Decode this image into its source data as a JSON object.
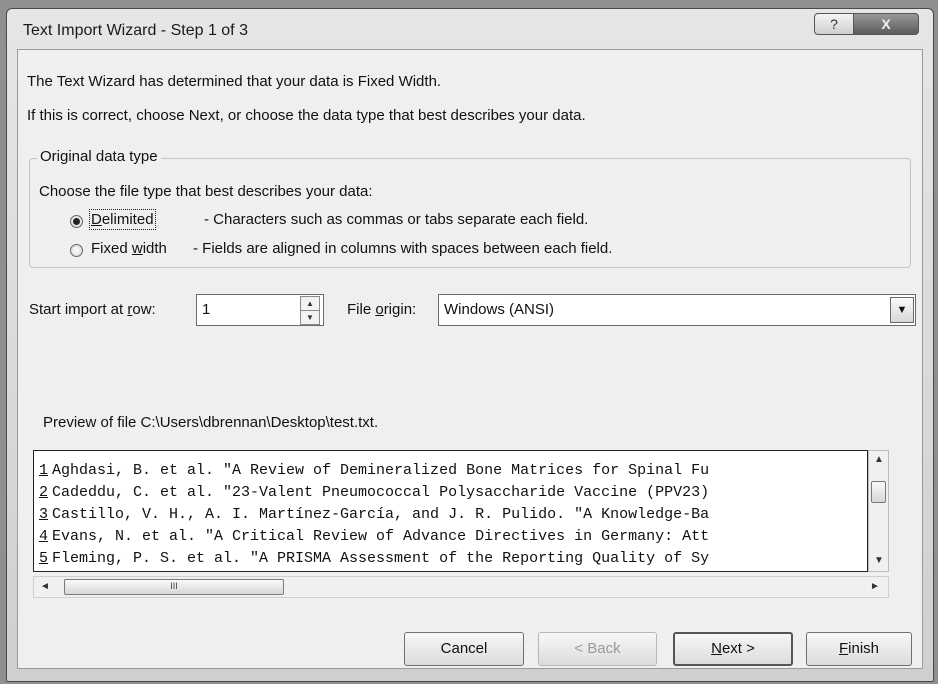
{
  "window": {
    "title": "Text Import Wizard - Step 1 of 3",
    "help_glyph": "?",
    "close_glyph": "X"
  },
  "intro": {
    "line1": "The Text Wizard has determined that your data is Fixed Width.",
    "line2": "If this is correct, choose Next, or choose the data type that best describes your data."
  },
  "data_type": {
    "group_label": "Original data type",
    "prompt": "Choose the file type that best describes your data:",
    "options": [
      {
        "label": "Delimited",
        "mnemonic": "D",
        "description": "- Characters such as commas or tabs separate each field.",
        "checked": true
      },
      {
        "label_pre": "Fixed ",
        "mnemonic": "w",
        "label_post": "idth",
        "description": "- Fields are aligned in columns with spaces between each field.",
        "checked": false
      }
    ]
  },
  "start_row": {
    "label_pre": "Start import at ",
    "mnemonic": "r",
    "label_post": "ow:",
    "value": "1"
  },
  "file_origin": {
    "label_pre": "File ",
    "mnemonic": "o",
    "label_post": "rigin:",
    "value": "Windows (ANSI)"
  },
  "preview": {
    "label": "Preview of file C:\\Users\\dbrennan\\Desktop\\test.txt.",
    "rows": [
      {
        "num": "1",
        "text": "Aghdasi, B. et al. \"A Review of Demineralized Bone Matrices for Spinal Fu"
      },
      {
        "num": "2",
        "text": "Cadeddu, C. et al. \"23-Valent Pneumococcal Polysaccharide Vaccine (PPV23)"
      },
      {
        "num": "3",
        "text": "Castillo, V. H., A. I. Martínez-García, and J. R. Pulido. \"A Knowledge-Ba"
      },
      {
        "num": "4",
        "text": "Evans, N. et al. \"A Critical Review of Advance Directives in Germany: Att"
      },
      {
        "num": "5",
        "text": "Fleming, P. S. et al. \"A PRISMA Assessment of the Reporting Quality of Sy"
      }
    ],
    "hscroll_grip": "III"
  },
  "buttons": {
    "cancel": "Cancel",
    "back": "< Back",
    "next_mnemonic": "N",
    "next_rest": "ext >",
    "finish_mnemonic": "F",
    "finish_rest": "inish"
  },
  "icons": {
    "spin_up": "▲",
    "spin_down": "▼",
    "dropdown": "▼",
    "arrow_up": "▲",
    "arrow_down": "▼",
    "arrow_left": "◄",
    "arrow_right": "►"
  }
}
